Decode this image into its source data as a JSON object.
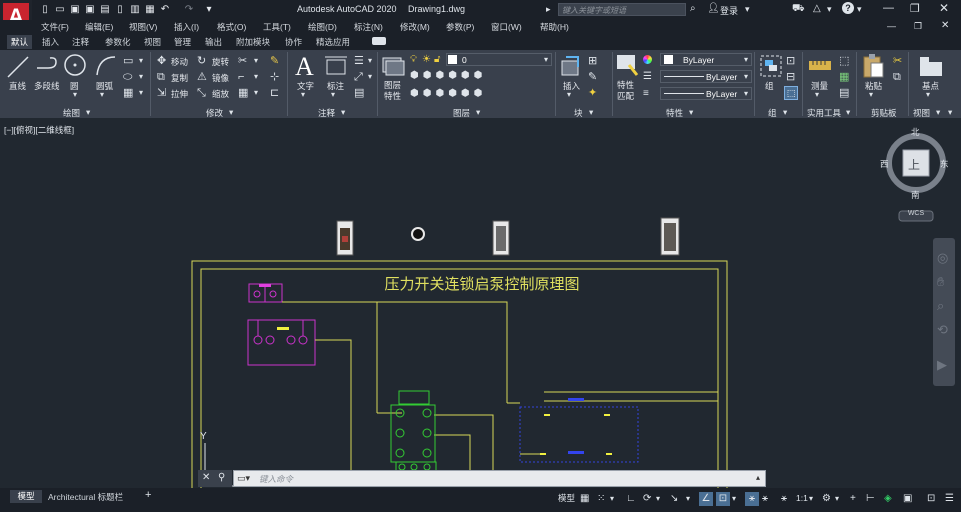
{
  "app": {
    "title": "Autodesk AutoCAD 2020",
    "filename": "Drawing1.dwg",
    "search_placeholder": "键入关键字或短语",
    "login": "登录",
    "help": "?"
  },
  "menu": [
    "文件(F)",
    "编辑(E)",
    "视图(V)",
    "插入(I)",
    "格式(O)",
    "工具(T)",
    "绘图(D)",
    "标注(N)",
    "修改(M)",
    "参数(P)",
    "窗口(W)",
    "帮助(H)"
  ],
  "ribbon_tabs": [
    "默认",
    "插入",
    "注释",
    "参数化",
    "视图",
    "管理",
    "输出",
    "附加模块",
    "协作",
    "精选应用"
  ],
  "ribbon": {
    "draw": {
      "line": "直线",
      "polyline": "多段线",
      "circle": "圆",
      "arc": "圆弧",
      "title": "绘图"
    },
    "modify": {
      "move": "移动",
      "rotate": "旋转",
      "copy": "复制",
      "mirror": "镜像",
      "stretch": "拉伸",
      "scale": "缩放",
      "title": "修改"
    },
    "annotation": {
      "text": "文字",
      "dimension": "标注",
      "title": "注释"
    },
    "layers": {
      "layer_props": "图层特性",
      "current_layer": "0",
      "title": "图层"
    },
    "block": {
      "insert": "插入",
      "title": "块"
    },
    "properties": {
      "match": "特性匹配",
      "bylayer1": "ByLayer",
      "bylayer2": "ByLayer",
      "bylayer3": "ByLayer",
      "title": "特性"
    },
    "groups": {
      "group": "组",
      "title": "组"
    },
    "utilities": {
      "measure": "测量",
      "title": "实用工具"
    },
    "clipboard": {
      "paste": "粘贴",
      "title": "剪贴板"
    },
    "view": {
      "base": "基点",
      "title": "视图"
    }
  },
  "viewport": {
    "label": "[−][俯视][二维线框]"
  },
  "viewcube": {
    "north": "北",
    "south": "南",
    "east": "东",
    "west": "西",
    "top": "上",
    "wcs": "WCS"
  },
  "drawing": {
    "title": "压力开关连锁启泵控制原理图",
    "y_axis": "Y"
  },
  "command": {
    "placeholder": "键入命令"
  },
  "layout_tabs": [
    "模型",
    "Architectural 标题栏"
  ],
  "status": {
    "model": "模型",
    "scale": "1:1"
  }
}
